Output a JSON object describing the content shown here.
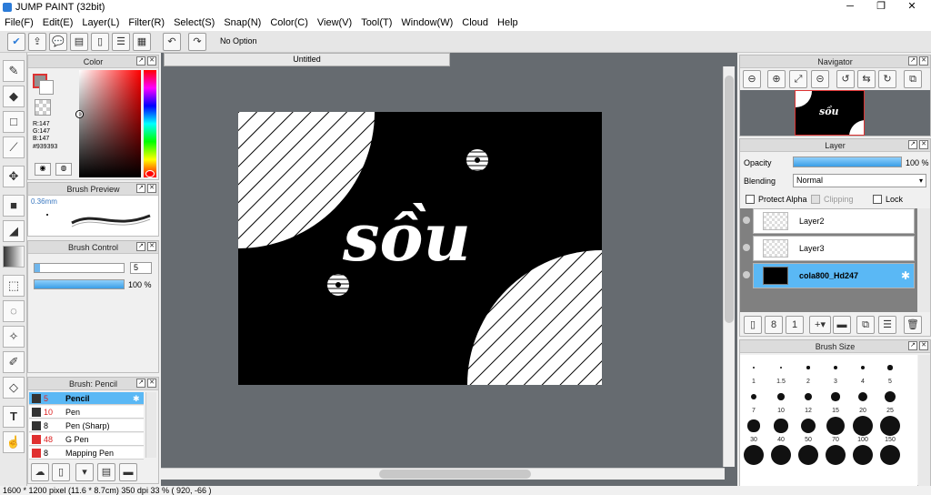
{
  "window": {
    "title": "JUMP PAINT (32bit)",
    "minimize": "─",
    "maximize": "❐",
    "close": "✕"
  },
  "menu": [
    "File(F)",
    "Edit(E)",
    "Layer(L)",
    "Filter(R)",
    "Select(S)",
    "Snap(N)",
    "Color(C)",
    "View(V)",
    "Tool(T)",
    "Window(W)",
    "Cloud",
    "Help"
  ],
  "toolbar": {
    "option_label": "No Option"
  },
  "color_panel": {
    "title": "Color",
    "r": "R:147",
    "g": "G:147",
    "b": "B:147",
    "hex": "#939393",
    "main_color": "#939393"
  },
  "brush_preview": {
    "title": "Brush Preview",
    "size": "0.36mm"
  },
  "brush_control": {
    "title": "Brush Control",
    "size_value": "5",
    "opacity_value": "100 %",
    "opacity_fraction": 1.0
  },
  "brush_list": {
    "title": "Brush: Pencil",
    "items": [
      {
        "size": "5",
        "name": "Pencil",
        "selected": true
      },
      {
        "size": "10",
        "name": "Pen"
      },
      {
        "size": "8",
        "name": "Pen (Sharp)"
      },
      {
        "size": "48",
        "name": "G Pen"
      },
      {
        "size": "8",
        "name": "Mapping Pen"
      }
    ]
  },
  "document": {
    "tab_title": "Untitled",
    "art_text": "sồu"
  },
  "navigator": {
    "title": "Navigator"
  },
  "layer_panel": {
    "title": "Layer",
    "opacity_label": "Opacity",
    "opacity_value": "100 %",
    "blending_label": "Blending",
    "blending_value": "Normal",
    "protect_alpha": "Protect Alpha",
    "clipping": "Clipping",
    "lock": "Lock",
    "layers": [
      {
        "name": "Layer2"
      },
      {
        "name": "Layer3"
      },
      {
        "name": "cola800_Hd247",
        "selected": true
      }
    ]
  },
  "brush_size": {
    "title": "Brush Size",
    "sizes": [
      "1",
      "1.5",
      "2",
      "3",
      "4",
      "5",
      "7",
      "10",
      "12",
      "15",
      "20",
      "25",
      "30",
      "40",
      "50",
      "70",
      "100",
      "150"
    ]
  },
  "status": {
    "text": "1600 * 1200 pixel  (11.6 * 8.7cm)  350 dpi  33 %  ( 920, -66 )"
  }
}
